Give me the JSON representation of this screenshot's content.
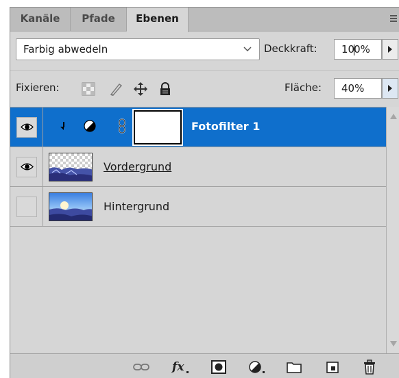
{
  "tabs": [
    {
      "label": "Kanäle"
    },
    {
      "label": "Pfade"
    },
    {
      "label": "Ebenen",
      "active": true
    }
  ],
  "blend_mode": {
    "value": "Farbig abwedeln"
  },
  "opacity": {
    "label": "Deckkraft:",
    "value_before_caret": "10",
    "value_after_caret": "0%"
  },
  "lock": {
    "label": "Fixieren:"
  },
  "fill": {
    "label": "Fläche:",
    "value": "40%"
  },
  "layers": [
    {
      "name": "Fotofilter 1",
      "selected": true,
      "visible": true,
      "type": "adjustment",
      "icon": "photo-filter-adjustment-icon"
    },
    {
      "name": "Vordergrund",
      "selected": false,
      "visible": true,
      "type": "pixel",
      "transparent_thumb": true
    },
    {
      "name": "Hintergrund",
      "selected": false,
      "visible": false,
      "type": "pixel"
    }
  ],
  "toolbar_icons": [
    "link-layers-icon",
    "fx-icon",
    "add-mask-icon",
    "adjustment-layer-icon",
    "new-group-icon",
    "new-layer-icon",
    "delete-layer-icon"
  ],
  "colors": {
    "selection": "#0f6fcc",
    "panel": "#d6d6d6",
    "tabbar": "#bcbcbc"
  }
}
